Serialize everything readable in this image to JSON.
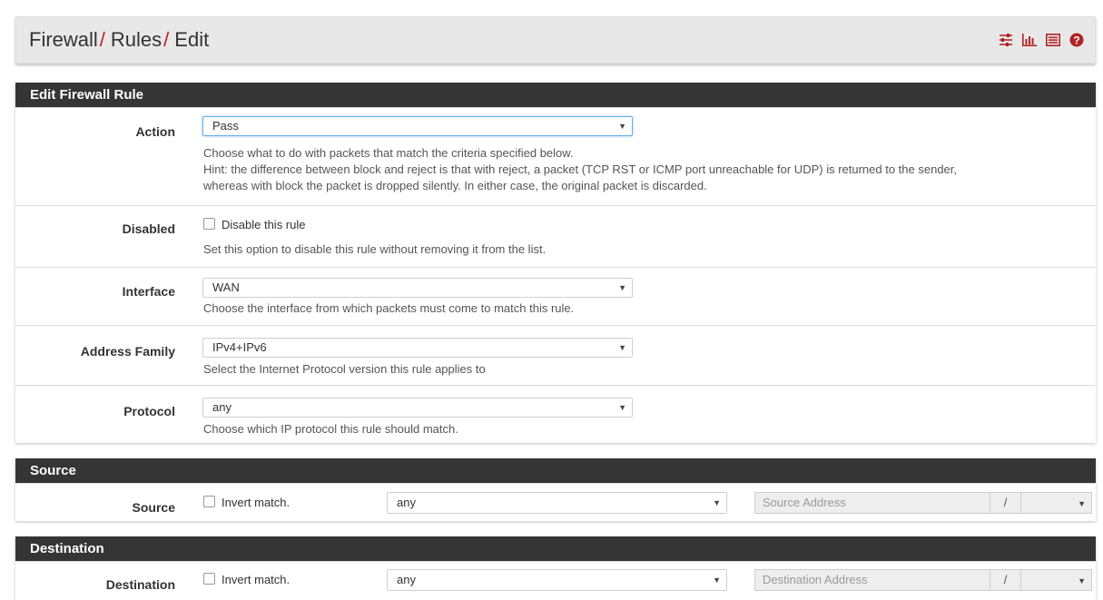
{
  "breadcrumb": {
    "items": [
      "Firewall",
      "Rules",
      "Edit"
    ],
    "separator": "/",
    "icons": [
      "sliders-icon",
      "bar-chart-icon",
      "list-icon",
      "help-icon"
    ]
  },
  "colors": {
    "accent": "#b22222",
    "panel_heading": "#353535"
  },
  "edit_panel": {
    "title": "Edit Firewall Rule",
    "action": {
      "label": "Action",
      "value": "Pass",
      "help_1": "Choose what to do with packets that match the criteria specified below.",
      "help_2": "Hint: the difference between block and reject is that with reject, a packet (TCP RST or ICMP port unreachable for UDP) is returned to the sender,",
      "help_3": "whereas with block the packet is dropped silently. In either case, the original packet is discarded."
    },
    "disabled": {
      "label": "Disabled",
      "checkbox_label": "Disable this rule",
      "checked": false,
      "help": "Set this option to disable this rule without removing it from the list."
    },
    "interface": {
      "label": "Interface",
      "value": "WAN",
      "help": "Choose the interface from which packets must come to match this rule."
    },
    "address_family": {
      "label": "Address Family",
      "value": "IPv4+IPv6",
      "help": "Select the Internet Protocol version this rule applies to"
    },
    "protocol": {
      "label": "Protocol",
      "value": "any",
      "help": "Choose which IP protocol this rule should match."
    }
  },
  "source_panel": {
    "title": "Source",
    "label": "Source",
    "invert_label": "Invert match.",
    "type_value": "any",
    "address_placeholder": "Source Address",
    "slash": "/"
  },
  "destination_panel": {
    "title": "Destination",
    "label": "Destination",
    "invert_label": "Invert match.",
    "type_value": "any",
    "address_placeholder": "Destination Address",
    "slash": "/"
  }
}
